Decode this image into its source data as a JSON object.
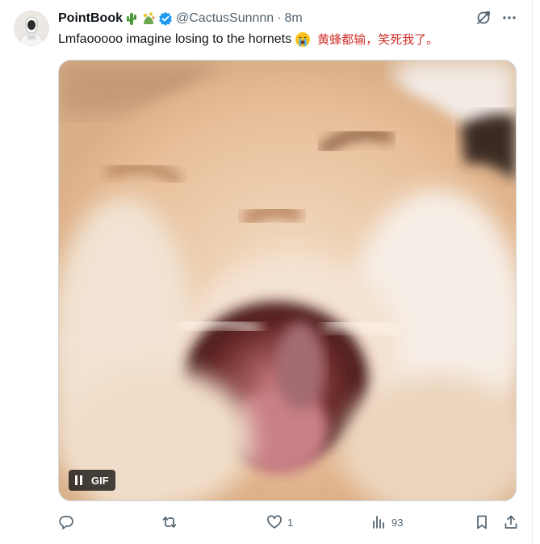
{
  "tweet": {
    "display_name": "PointBook",
    "name_emojis": [
      "cactus-icon",
      "sparkling-plant-icon"
    ],
    "verified": true,
    "handle": "@CactusSunnnn",
    "separator": "·",
    "time": "8m",
    "text": "Lmfaooooo imagine losing to the hornets",
    "text_emoji": "loudly-crying-face-icon",
    "translation": "黄蜂都输，笑死我了。",
    "media": {
      "type": "gif",
      "badge_label": "GIF",
      "subject": "laughing-cat-gif"
    },
    "actions": {
      "replies": "",
      "retweets": "",
      "likes": "1",
      "views": "93"
    }
  },
  "colors": {
    "verified_blue": "#1d9bf0",
    "secondary_text": "#536471",
    "translation_red": "#d3312c",
    "border": "#cfd9de"
  }
}
